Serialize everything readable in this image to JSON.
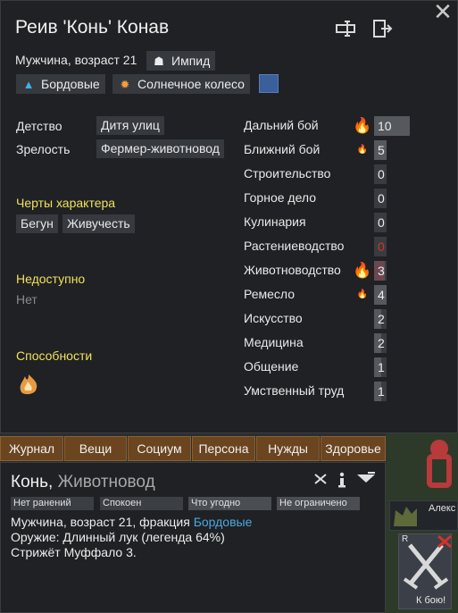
{
  "card": {
    "name": "Реив 'Конь' Конав",
    "gender_age": "Мужчина, возраст 21",
    "xenotype_label": "Импид",
    "faction_label": "Бордовые",
    "ideology_label": "Солнечное колесо",
    "childhood_label": "Детство",
    "childhood_value": "Дитя улиц",
    "adulthood_label": "Зрелость",
    "adulthood_value": "Фермер-животновод",
    "traits_title": "Черты характера",
    "traits": [
      "Бегун",
      "Живучесть"
    ],
    "incapable_title": "Недоступно",
    "incapable_value": "Нет",
    "abilities_title": "Способности",
    "accent_color": "#3a5f9a"
  },
  "skills": [
    {
      "name": "Дальний бой",
      "level": "10",
      "passion": "major"
    },
    {
      "name": "Ближний бой",
      "level": "5",
      "passion": "minor"
    },
    {
      "name": "Строительство",
      "level": "0",
      "passion": "none"
    },
    {
      "name": "Горное дело",
      "level": "0",
      "passion": "none"
    },
    {
      "name": "Кулинария",
      "level": "0",
      "passion": "none"
    },
    {
      "name": "Растениеводство",
      "level": "0",
      "passion": "none",
      "disabled": true
    },
    {
      "name": "Животноводство",
      "level": "3",
      "passion": "major"
    },
    {
      "name": "Ремесло",
      "level": "4",
      "passion": "minor"
    },
    {
      "name": "Искусство",
      "level": "2",
      "passion": "none"
    },
    {
      "name": "Медицина",
      "level": "2",
      "passion": "none"
    },
    {
      "name": "Общение",
      "level": "1",
      "passion": "none"
    },
    {
      "name": "Умственный труд",
      "level": "1",
      "passion": "none"
    }
  ],
  "tabs": [
    "Журнал",
    "Вещи",
    "Социум",
    "Персона",
    "Нужды",
    "Здоровье"
  ],
  "inspect": {
    "name": "Конь",
    "separator": ", ",
    "role": "Животновод",
    "health_state": "Нет ранений",
    "mood_state": "Спокоен",
    "food_restriction": "Что угодно",
    "area_restriction": "Не ограничено",
    "desc_prefix": "Мужчина, возраст 21, фракция ",
    "desc_faction": "Бордовые",
    "weapon": "Оружие: Длинный лук (легенда 64%)",
    "job": "Стрижёт Муффало 3."
  },
  "world": {
    "colonist_name": "Алекс",
    "hotkey": "R",
    "attack_label": "К бою!"
  }
}
